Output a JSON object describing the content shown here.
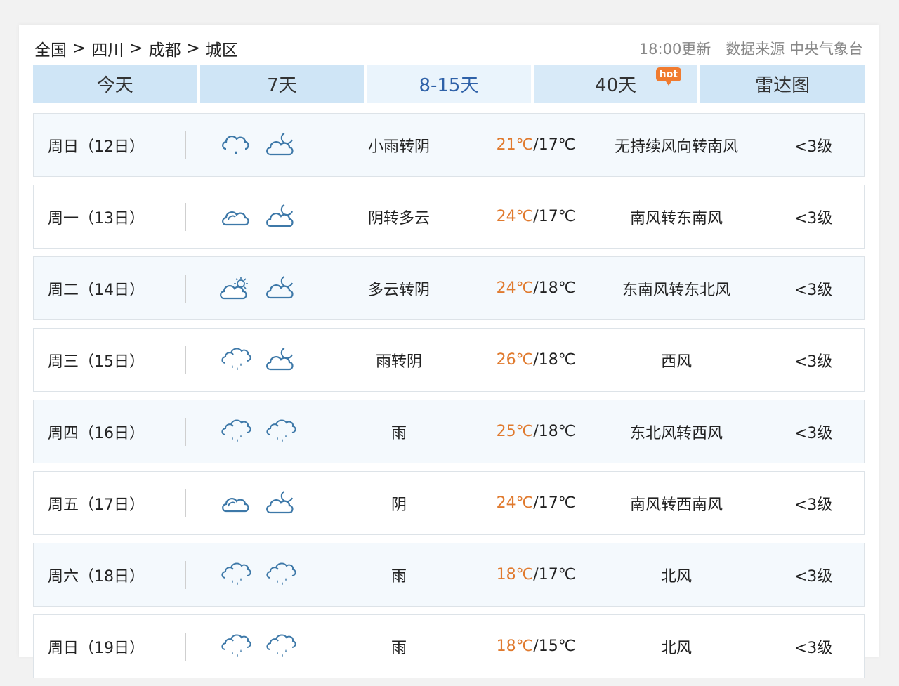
{
  "breadcrumb": [
    "全国",
    "四川",
    "成都",
    "城区"
  ],
  "breadcrumb_sep": ">",
  "meta": {
    "updated": "18:00更新",
    "source": "数据来源 中央气象台"
  },
  "tabs": [
    {
      "label": "今天"
    },
    {
      "label": "7天"
    },
    {
      "label": "8-15天",
      "active": true
    },
    {
      "label": "40天",
      "badge": "hot"
    },
    {
      "label": "雷达图"
    }
  ],
  "colors": {
    "tab_bg": "#cfe5f6",
    "tab_active_text": "#2f61a8",
    "high_temp": "#e07a2e",
    "hot_badge": "#f07b30",
    "icon_stroke": "#3d78a8"
  },
  "forecast": [
    {
      "day": "周日（12日）",
      "icons": [
        "cloud-rain-icon",
        "cloud-moon-icon"
      ],
      "desc": "小雨转阴",
      "high": "21℃",
      "low": "/17℃",
      "wind": "无持续风向转南风",
      "level": "<3级"
    },
    {
      "day": "周一（13日）",
      "icons": [
        "cloud-icon",
        "cloud-moon-icon"
      ],
      "desc": "阴转多云",
      "high": "24℃",
      "low": "/17℃",
      "wind": "南风转东南风",
      "level": "<3级"
    },
    {
      "day": "周二（14日）",
      "icons": [
        "cloud-sun-icon",
        "cloud-moon-icon"
      ],
      "desc": "多云转阴",
      "high": "24℃",
      "low": "/18℃",
      "wind": "东南风转东北风",
      "level": "<3级"
    },
    {
      "day": "周三（15日）",
      "icons": [
        "rain-icon",
        "cloud-moon-icon"
      ],
      "desc": "雨转阴",
      "high": "26℃",
      "low": "/18℃",
      "wind": "西风",
      "level": "<3级"
    },
    {
      "day": "周四（16日）",
      "icons": [
        "rain-icon",
        "rain-icon"
      ],
      "desc": "雨",
      "high": "25℃",
      "low": "/18℃",
      "wind": "东北风转西风",
      "level": "<3级"
    },
    {
      "day": "周五（17日）",
      "icons": [
        "cloud-icon",
        "cloud-moon-icon"
      ],
      "desc": "阴",
      "high": "24℃",
      "low": "/17℃",
      "wind": "南风转西南风",
      "level": "<3级"
    },
    {
      "day": "周六（18日）",
      "icons": [
        "rain-icon",
        "rain-icon"
      ],
      "desc": "雨",
      "high": "18℃",
      "low": "/17℃",
      "wind": "北风",
      "level": "<3级"
    },
    {
      "day": "周日（19日）",
      "icons": [
        "rain-icon",
        "rain-icon"
      ],
      "desc": "雨",
      "high": "18℃",
      "low": "/15℃",
      "wind": "北风",
      "level": "<3级"
    }
  ]
}
